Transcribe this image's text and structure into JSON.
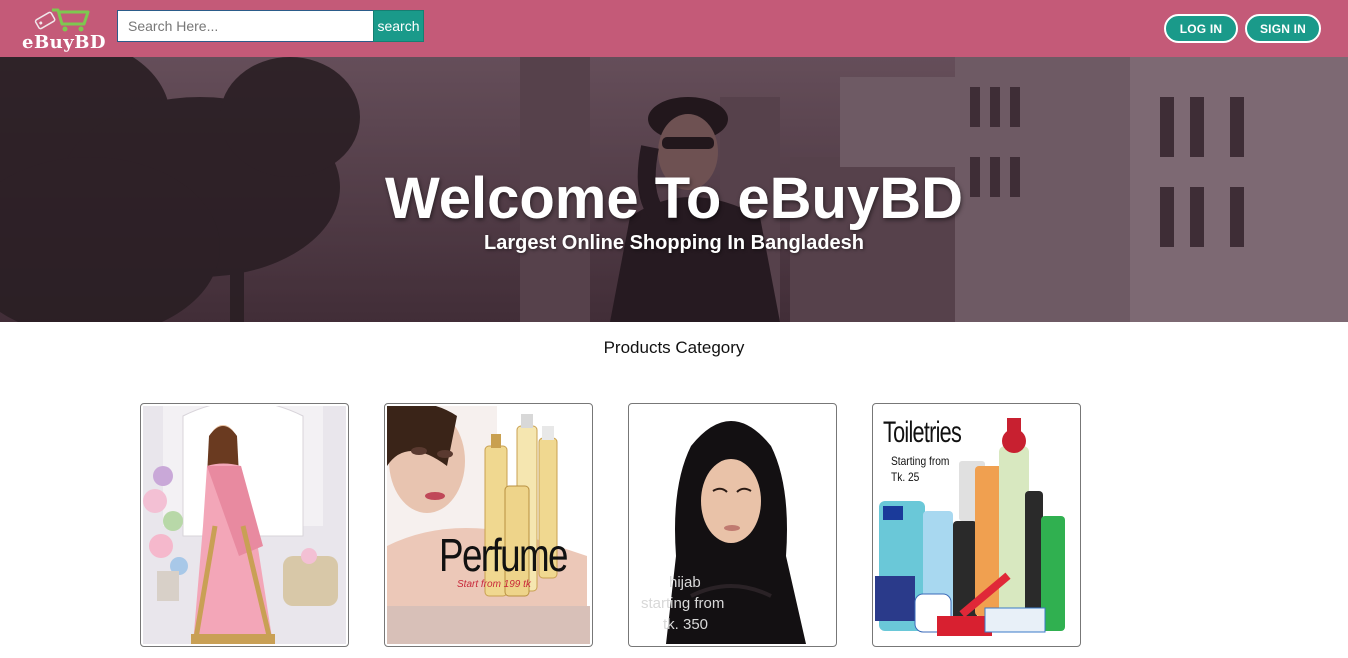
{
  "header": {
    "logo_text": "eBuyBD",
    "search_placeholder": "Search Here...",
    "search_button": "search",
    "login_button": "LOG IN",
    "signin_button": "SIGN IN"
  },
  "hero": {
    "title": "Welcome To eBuyBD",
    "subtitle": "Largest Online Shopping In Bangladesh"
  },
  "categories": {
    "title": "Products Category",
    "items": [
      {
        "name": "saree"
      },
      {
        "name": "perfume",
        "image_title": "Perfume",
        "image_caption": "Start from 199 tk"
      },
      {
        "name": "hijab",
        "caption_line1": "hijab",
        "caption_line2": "starting from",
        "caption_line3": "tk. 350"
      },
      {
        "name": "toiletries",
        "image_title": "Toiletries",
        "caption_line1": "Starting from",
        "caption_line2": "Tk. 25"
      }
    ]
  },
  "colors": {
    "header_bg": "#c45a78",
    "accent": "#1a9a8a",
    "hero_tint": "#4a3640"
  }
}
